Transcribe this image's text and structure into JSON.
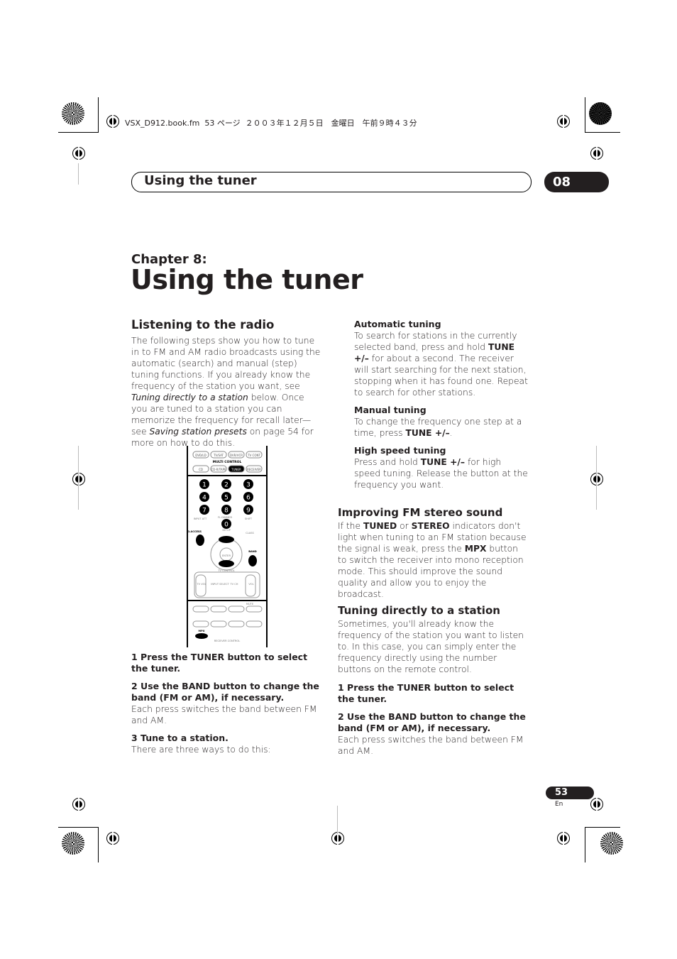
{
  "slug": "VSX_D912.book.fm  53 ページ  ２００３年１２月５日　金曜日　午前９時４３分",
  "header": {
    "title": "Using the tuner",
    "chapter_num": "08"
  },
  "chapter": {
    "label": "Chapter 8:",
    "title": "Using the tuner"
  },
  "left": {
    "heading": "Listening to the radio",
    "intro": [
      "The following steps show you how to tune in to FM and AM radio broadcasts using the automatic (search) and manual (step) tuning functions. If you already know the frequency of the station you want, see ",
      "Tuning directly to a station",
      " below. Once you are tuned to a station you can memorize the frequency for recall later—see ",
      "Saving station presets",
      " on page 54 for more on how to do this."
    ],
    "step1": "1    Press the TUNER button to select the tuner.",
    "step2": "2    Use the BAND button to change the band (FM or AM), if necessary.",
    "step2_body": "Each press switches the band between FM and AM.",
    "step3": "3    Tune to a station.",
    "step3_body": "There are three ways to do this:"
  },
  "remote": {
    "top_row": [
      "DVD/LD",
      "TV/SAT",
      "DVR/VCR",
      "TV CONT"
    ],
    "multi": "MULTI CONTROL",
    "second_row": [
      "CD",
      "CD-R/TAPE",
      "TUNER",
      "RECEIVER"
    ],
    "digits": [
      "1",
      "2",
      "3",
      "4",
      "5",
      "6",
      "7",
      "8",
      "9",
      "0"
    ],
    "labels": [
      "INPUT ATT",
      "FL DIMMER",
      "SHIFT",
      "D.ACCESS",
      "SETUP",
      "CLASS",
      "ENTER",
      "BAND",
      "TV CONTROL",
      "TV VOL",
      "INPUT SELECT",
      "TV CH",
      "VOL",
      "MUTE",
      "MPX",
      "RECEIVER CONTROL"
    ]
  },
  "right": {
    "auto_h": "Automatic tuning",
    "auto": [
      "To search for stations in the currently selected band, press and hold ",
      "TUNE +/–",
      " for about a second. The receiver will start searching for the next station, stopping when it has found one. Repeat to search for other stations."
    ],
    "manual_h": "Manual tuning",
    "manual": [
      "To change the frequency one step at a time, press ",
      "TUNE +/–",
      "."
    ],
    "high_h": "High speed tuning",
    "high": [
      "Press and hold ",
      "TUNE +/–",
      " for high speed tuning. Release the button at the frequency you want."
    ],
    "fm_h": "Improving FM stereo sound",
    "fm": [
      "If the ",
      "TUNED",
      " or ",
      "STEREO",
      " indicators don't light when tuning to an FM station because the signal is weak, press the ",
      "MPX",
      " button to switch the receiver into mono reception mode. This should improve the sound quality and allow you to enjoy the broadcast."
    ],
    "direct_h": "Tuning directly to a station",
    "direct": "Sometimes, you'll already know the frequency of the station you want to listen to. In this case, you can simply enter the frequency directly using the number buttons on the remote control.",
    "step1": "1    Press the TUNER button to select the tuner.",
    "step2": "2    Use the BAND button to change the band (FM or AM), if necessary.",
    "step2_body": "Each press switches the band between FM and AM."
  },
  "footer": {
    "page": "53",
    "lang": "En"
  }
}
